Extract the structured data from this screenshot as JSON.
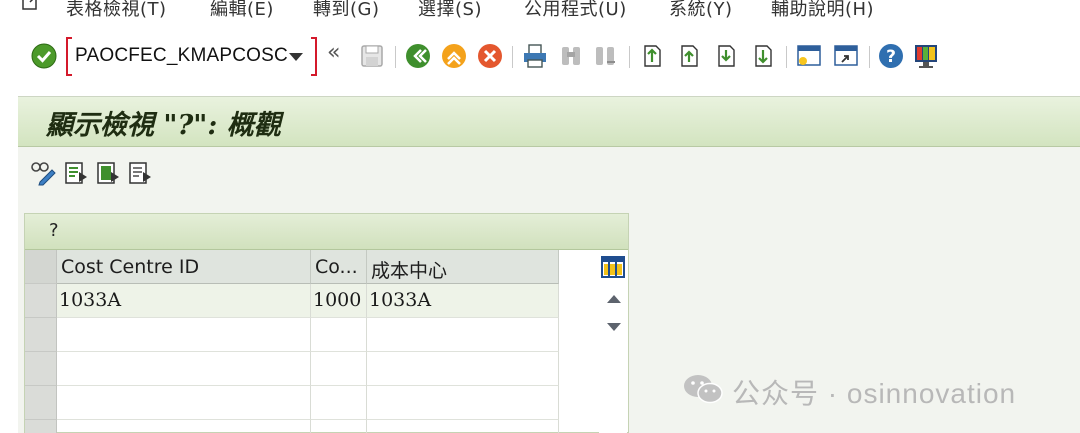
{
  "menubar": {
    "items": [
      {
        "label": "表格檢視(T)"
      },
      {
        "label": "編輯(E)"
      },
      {
        "label": "轉到(G)"
      },
      {
        "label": "選擇(S)"
      },
      {
        "label": "公用程式(U)"
      },
      {
        "label": "系統(Y)"
      },
      {
        "label": "輔助說明(H)"
      }
    ]
  },
  "toolbar": {
    "command_field_value": "PAOCFEC_KMAPCOSC",
    "history_glyph": "«",
    "icons": [
      "enter-icon",
      "save-icon",
      "back-icon",
      "exit-icon",
      "cancel-icon",
      "print-icon",
      "find-icon",
      "find-next-icon",
      "first-page-icon",
      "previous-page-icon",
      "next-page-icon",
      "last-page-icon",
      "create-session-icon",
      "generate-shortcut-icon",
      "help-icon",
      "customize-layout-icon"
    ]
  },
  "page": {
    "title": "顯示檢視 \"?\": 概觀"
  },
  "app_toolbar": {
    "icons": [
      "display-change-icon",
      "details-icon",
      "select-all-icon",
      "deselect-all-icon"
    ]
  },
  "grid": {
    "caption": "?",
    "columns": [
      {
        "label": "Cost Centre ID"
      },
      {
        "label": "Co..."
      },
      {
        "label": "成本中心"
      }
    ],
    "rows": [
      {
        "cost_centre_id": "1033A",
        "company": "1000",
        "cost_center": "1033A"
      }
    ]
  },
  "watermark": {
    "text": "公众号 · osinnovation"
  },
  "colors": {
    "title_band": "#d3e4c0",
    "command_field_border": "#d4192b",
    "grid_header": "#dfe4de"
  }
}
